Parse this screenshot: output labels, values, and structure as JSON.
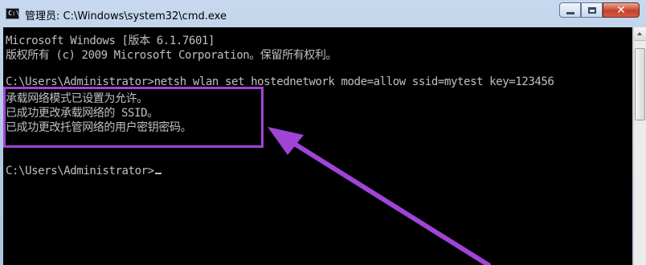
{
  "window": {
    "title": "管理员: C:\\Windows\\system32\\cmd.exe",
    "icon_text": "C:\\"
  },
  "console": {
    "lines": [
      "Microsoft Windows [版本 6.1.7601]",
      "版权所有 (c) 2009 Microsoft Corporation。保留所有权利。",
      "",
      "C:\\Users\\Administrator>netsh wlan set hostednetwork mode=allow ssid=mytest key=123456",
      "承载网络模式已设置为允许。",
      "已成功更改承载网络的 SSID。",
      "已成功更改托管网络的用户密钥密码。",
      "",
      "C:\\Users\\Administrator>"
    ]
  },
  "annotation": {
    "color": "#a044d6"
  },
  "icons": [
    "cmd-icon",
    "minimize-icon",
    "maximize-icon",
    "close-icon",
    "scroll-up-arrow-icon"
  ]
}
